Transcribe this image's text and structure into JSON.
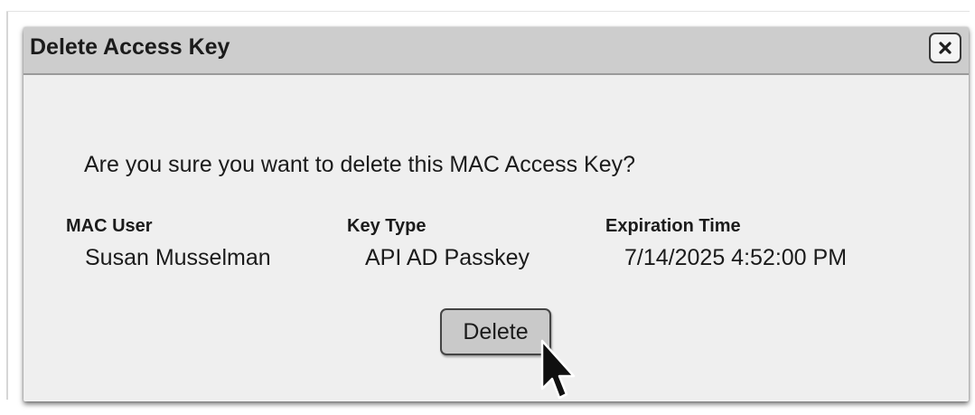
{
  "dialog": {
    "title": "Delete Access Key",
    "close_icon": "close-icon",
    "question": "Are you sure you want to delete this MAC Access Key?",
    "columns": [
      {
        "label": "MAC User",
        "value": "Susan Musselman"
      },
      {
        "label": "Key Type",
        "value": "API AD Passkey"
      },
      {
        "label": "Expiration Time",
        "value": "7/14/2025 4:52:00 PM"
      }
    ],
    "delete_label": "Delete"
  },
  "colors": {
    "titlebar": "#cdcdcd",
    "dialog_body": "#efefef",
    "button": "#c9c9c9",
    "text": "#1b1b1b"
  },
  "cursor_icon": "mouse-pointer-icon"
}
